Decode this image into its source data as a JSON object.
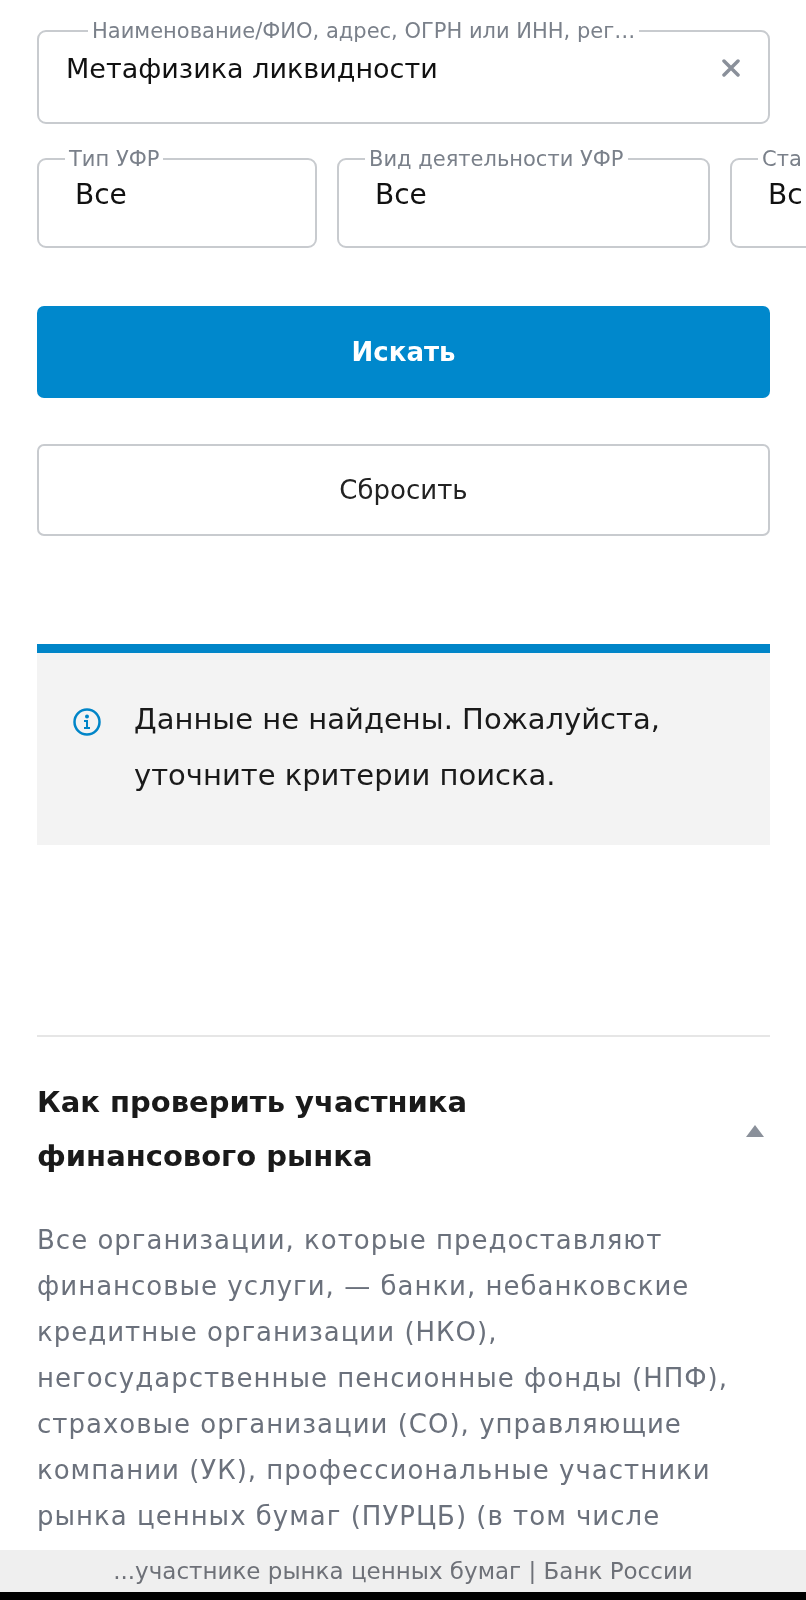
{
  "search": {
    "label": "Наименование/ФИО, адрес, ОГРН или ИНН, рег…",
    "value": "Метафизика ликвидности"
  },
  "filters": [
    {
      "label": "Тип УФР",
      "value": "Все"
    },
    {
      "label": "Вид деятельности УФР",
      "value": "Все"
    },
    {
      "label": "Ста",
      "value": "Вс"
    }
  ],
  "buttons": [
    {
      "kind": "primary",
      "label": "Искать"
    },
    {
      "kind": "secondary",
      "label": "Сбросить"
    }
  ],
  "alert": {
    "text": "Данные не найдены. Пожалуйста, уточните критерии поиска."
  },
  "section": {
    "title": "Как проверить участника финансового рынка",
    "expanded": true,
    "text": "Все организации, которые предоставляют финансовые услуги, — банки, небанковские кредитные организации (НКО), негосударственные пенсионные фонды (НПФ), страховые организации (СО), управляющие компании (УК), профессиональные участники рынка ценных бумаг (ПУРЦБ) (в том числе"
  },
  "page_title_bar": {
    "text": "...участнике рынка ценных бумаг | Банк России"
  }
}
